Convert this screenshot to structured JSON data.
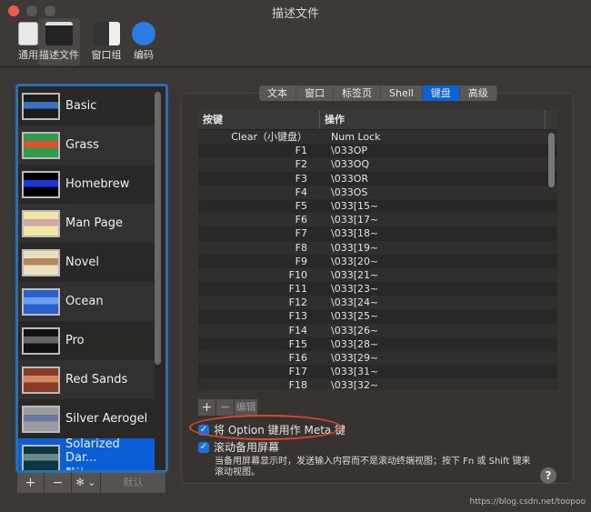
{
  "window": {
    "title": "描述文件"
  },
  "toolbar": [
    {
      "label": "通用",
      "icon": "switch-icon"
    },
    {
      "label": "描述文件",
      "icon": "terminal-icon",
      "selected": true
    },
    {
      "label": "窗口组",
      "icon": "window-group-icon"
    },
    {
      "label": "编码",
      "icon": "globe-icon"
    }
  ],
  "profiles": [
    {
      "name": "Basic",
      "thumb": "#1c1c1c",
      "accent": "#3b6fbf"
    },
    {
      "name": "Grass",
      "thumb": "#2f9a4a",
      "accent": "#e0502a"
    },
    {
      "name": "Homebrew",
      "thumb": "#000000",
      "accent": "#1a3ad8"
    },
    {
      "name": "Man Page",
      "thumb": "#f3e6a0",
      "accent": "#caa"
    },
    {
      "name": "Novel",
      "thumb": "#eadfbf",
      "accent": "#b08a5a"
    },
    {
      "name": "Ocean",
      "thumb": "#2b5fcc",
      "accent": "#6aa0f0"
    },
    {
      "name": "Pro",
      "thumb": "#111111",
      "accent": "#666"
    },
    {
      "name": "Red Sands",
      "thumb": "#8a3a26",
      "accent": "#d08a60"
    },
    {
      "name": "Silver Aerogel",
      "thumb": "#9a9c9e",
      "accent": "#6a7aa0"
    },
    {
      "name": "Solarized Dar...",
      "sub": "默认",
      "thumb": "#0b3540",
      "accent": "#6a8a8a",
      "selected": true
    }
  ],
  "list_buttons": {
    "add": "+",
    "remove": "−",
    "gear": "✻ ⌄",
    "default": "默认"
  },
  "tabs": [
    {
      "label": "文本"
    },
    {
      "label": "窗口"
    },
    {
      "label": "标签页"
    },
    {
      "label": "Shell"
    },
    {
      "label": "键盘",
      "selected": true
    },
    {
      "label": "高级"
    }
  ],
  "table": {
    "headers": [
      "按键",
      "操作"
    ],
    "rows": [
      [
        "Clear（小键盘）",
        "Num Lock"
      ],
      [
        "F1",
        "\\033OP"
      ],
      [
        "F2",
        "\\033OQ"
      ],
      [
        "F3",
        "\\033OR"
      ],
      [
        "F4",
        "\\033OS"
      ],
      [
        "F5",
        "\\033[15~"
      ],
      [
        "F6",
        "\\033[17~"
      ],
      [
        "F7",
        "\\033[18~"
      ],
      [
        "F8",
        "\\033[19~"
      ],
      [
        "F9",
        "\\033[20~"
      ],
      [
        "F10",
        "\\033[21~"
      ],
      [
        "F11",
        "\\033[23~"
      ],
      [
        "F12",
        "\\033[24~"
      ],
      [
        "F13",
        "\\033[25~"
      ],
      [
        "F14",
        "\\033[26~"
      ],
      [
        "F15",
        "\\033[28~"
      ],
      [
        "F16",
        "\\033[29~"
      ],
      [
        "F17",
        "\\033[31~"
      ],
      [
        "F18",
        "\\033[32~"
      ]
    ]
  },
  "table_buttons": {
    "add": "+",
    "remove": "−",
    "edit": "编辑"
  },
  "options": {
    "option_meta": {
      "label": "将 Option 键用作 Meta 键",
      "checked": true
    },
    "scroll_alt": {
      "label": "滚动备用屏幕",
      "checked": true
    },
    "description": "当备用屏幕显示时，发送输入内容而不是滚动终端视图；按下 Fn 或 Shift 键来滚动视图。"
  },
  "help": "?",
  "watermark": "https://blog.csdn.net/toopoo",
  "colors": {
    "accent": "#0b63d8",
    "annotation": "#e0442b"
  }
}
